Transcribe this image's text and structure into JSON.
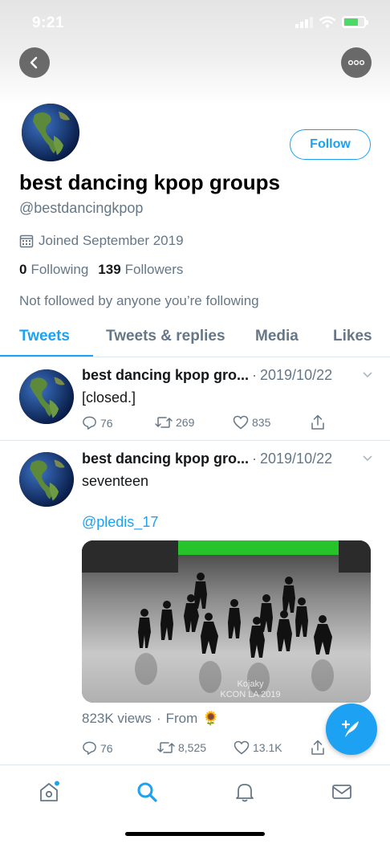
{
  "status_bar": {
    "time": "9:21"
  },
  "profile": {
    "follow_label": "Follow",
    "display_name": "best dancing kpop groups",
    "handle": "@bestdancingkpop",
    "joined": "Joined September 2019",
    "following_count": "0",
    "following_label": "Following",
    "followers_count": "139",
    "followers_label": "Followers",
    "not_followed_text": "Not followed by anyone you’re following"
  },
  "tabs": [
    "Tweets",
    "Tweets & replies",
    "Media",
    "Likes"
  ],
  "active_tab": "Tweets",
  "tweets": [
    {
      "author": "best dancing kpop gro...",
      "date": "2019/10/22",
      "text": "[closed.]",
      "replies": "76",
      "retweets": "269",
      "likes": "835"
    },
    {
      "author": "best dancing kpop gro...",
      "date": "2019/10/22",
      "text": "seventeen",
      "mention": "@pledis_17",
      "media_caption_line1": "Kojaky",
      "media_caption_line2": "KCON LA 2019",
      "views": "823K views",
      "from": "From",
      "from_emoji": "🌻",
      "replies": "76",
      "retweets": "8,525",
      "likes": "13.1K"
    }
  ],
  "colors": {
    "accent": "#1da1f2",
    "secondary_text": "#657786",
    "divider": "#e1e8ed"
  },
  "icons": [
    "back-arrow-icon",
    "more-icon",
    "calendar-icon",
    "chevron-down-icon",
    "reply-icon",
    "retweet-icon",
    "like-icon",
    "share-icon",
    "compose-icon",
    "home-icon",
    "search-icon",
    "notifications-icon",
    "messages-icon"
  ]
}
